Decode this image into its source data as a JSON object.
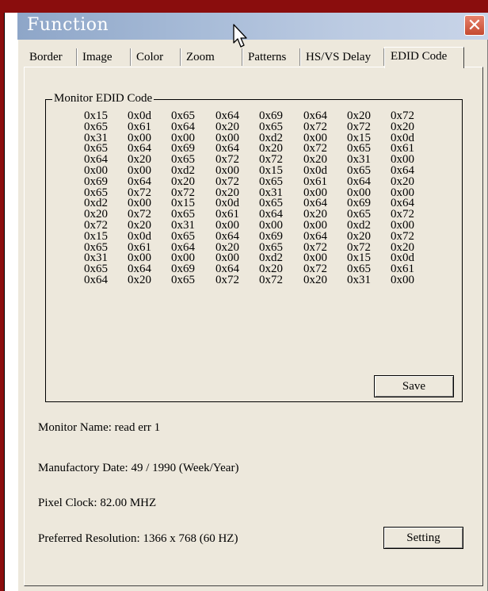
{
  "window": {
    "title": "Function",
    "close_glyph": "✕"
  },
  "tabs": [
    {
      "label": "Border",
      "active": false
    },
    {
      "label": "Image",
      "active": false
    },
    {
      "label": "Color",
      "active": false
    },
    {
      "label": "Zoom",
      "active": false
    },
    {
      "label": "Patterns",
      "active": false
    },
    {
      "label": "HS/VS Delay",
      "active": false
    },
    {
      "label": "EDID Code",
      "active": true
    }
  ],
  "edid": {
    "group_title": "Monitor EDID Code",
    "rows": [
      [
        "0x15",
        "0x0d",
        "0x65",
        "0x64",
        "0x69",
        "0x64",
        "0x20",
        "0x72"
      ],
      [
        "0x65",
        "0x61",
        "0x64",
        "0x20",
        "0x65",
        "0x72",
        "0x72",
        "0x20"
      ],
      [
        "0x31",
        "0x00",
        "0x00",
        "0x00",
        "0xd2",
        "0x00",
        "0x15",
        "0x0d"
      ],
      [
        "0x65",
        "0x64",
        "0x69",
        "0x64",
        "0x20",
        "0x72",
        "0x65",
        "0x61"
      ],
      [
        "0x64",
        "0x20",
        "0x65",
        "0x72",
        "0x72",
        "0x20",
        "0x31",
        "0x00"
      ],
      [
        "0x00",
        "0x00",
        "0xd2",
        "0x00",
        "0x15",
        "0x0d",
        "0x65",
        "0x64"
      ],
      [
        "0x69",
        "0x64",
        "0x20",
        "0x72",
        "0x65",
        "0x61",
        "0x64",
        "0x20"
      ],
      [
        "0x65",
        "0x72",
        "0x72",
        "0x20",
        "0x31",
        "0x00",
        "0x00",
        "0x00"
      ],
      [
        "0xd2",
        "0x00",
        "0x15",
        "0x0d",
        "0x65",
        "0x64",
        "0x69",
        "0x64"
      ],
      [
        "0x20",
        "0x72",
        "0x65",
        "0x61",
        "0x64",
        "0x20",
        "0x65",
        "0x72"
      ],
      [
        "0x72",
        "0x20",
        "0x31",
        "0x00",
        "0x00",
        "0x00",
        "0xd2",
        "0x00"
      ],
      [
        "0x15",
        "0x0d",
        "0x65",
        "0x64",
        "0x69",
        "0x64",
        "0x20",
        "0x72"
      ],
      [
        "0x65",
        "0x61",
        "0x64",
        "0x20",
        "0x65",
        "0x72",
        "0x72",
        "0x20"
      ],
      [
        "0x31",
        "0x00",
        "0x00",
        "0x00",
        "0xd2",
        "0x00",
        "0x15",
        "0x0d"
      ],
      [
        "0x65",
        "0x64",
        "0x69",
        "0x64",
        "0x20",
        "0x72",
        "0x65",
        "0x61"
      ],
      [
        "0x64",
        "0x20",
        "0x65",
        "0x72",
        "0x72",
        "0x20",
        "0x31",
        "0x00"
      ]
    ],
    "save_label": "Save"
  },
  "info": {
    "monitor_name": "Monitor Name: read err 1",
    "manufactory_date": "Manufactory Date: 49 / 1990 (Week/Year)",
    "pixel_clock": "Pixel Clock: 82.00 MHZ",
    "preferred_resolution": "Preferred Resolution: 1366 x 768 (60 HZ)"
  },
  "setting_label": "Setting",
  "colors": {
    "frame_red": "#8a0d0d",
    "dialog_face": "#ede8dc",
    "title_gradient_start": "#8ea6c8",
    "close_red": "#c44a30"
  }
}
